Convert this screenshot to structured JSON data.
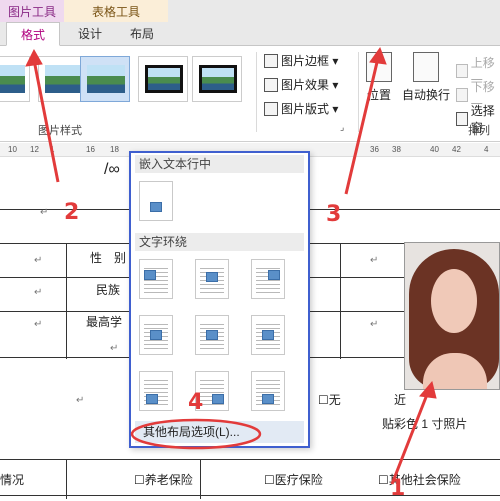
{
  "ribbon": {
    "context_picture_tools": "图片工具",
    "context_table_tools": "表格工具",
    "tabs": [
      "格式",
      "设计",
      "布局"
    ],
    "picture_styles_label": "图片样式",
    "commands": {
      "picture_border": "图片边框 ▾",
      "picture_effects": "图片效果 ▾",
      "picture_layout": "图片版式 ▾",
      "position": "位置",
      "wrap_text": "自动换行",
      "bring_forward": "上移一",
      "send_backward": "下移一",
      "selection_pane": "选择窗",
      "arrange_label": "排列"
    }
  },
  "ruler": [
    "10",
    "12",
    "1",
    "16",
    "18",
    "36",
    "38",
    "40",
    "42",
    "4"
  ],
  "document": {
    "top_fragment": "/∞",
    "cells": {
      "gender": "性　别",
      "ethnicity": "民族",
      "education": "最高学",
      "none_option": "☐无",
      "recent_prefix": "近",
      "photo_caption": "贴彩色 1 寸照片",
      "insurance_prefix": "情况",
      "pension": "☐养老保险",
      "medical": "☐医疗保险",
      "social": "☐其他社会保险"
    },
    "para_mark": "↵"
  },
  "popup": {
    "inline_header": "嵌入文本行中",
    "wrap_header": "文字环绕",
    "more_options": "其他布局选项(L)..."
  },
  "annotations": [
    "1",
    "2",
    "3",
    "4"
  ],
  "colors": {
    "annotation": "#e23b3b",
    "popup_border": "#3f5fcf",
    "tab_active": "#b0007e"
  }
}
